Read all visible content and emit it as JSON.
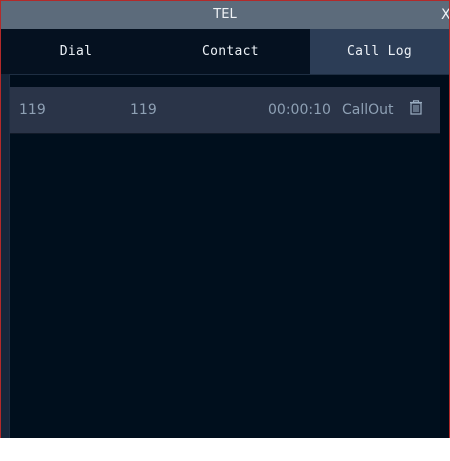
{
  "window": {
    "title": "TEL",
    "close_label": "X"
  },
  "tabs": [
    {
      "label": "Dial"
    },
    {
      "label": "Contact"
    },
    {
      "label": "Call Log",
      "selected": true
    }
  ],
  "call_log": {
    "rows": [
      {
        "number_a": "119",
        "number_b": "119",
        "duration": "00:00:10",
        "type": "CallOut",
        "delete_icon": "trash-icon"
      }
    ]
  },
  "colors": {
    "title_bar": "#5c6b7b",
    "tab_bar": "#051120",
    "selected_tab": "#2c3d56",
    "list_bg": "#000d1b",
    "row_bg": "#2a3448",
    "row_text": "#8ea0b4",
    "window_border": "#b22a2a"
  }
}
